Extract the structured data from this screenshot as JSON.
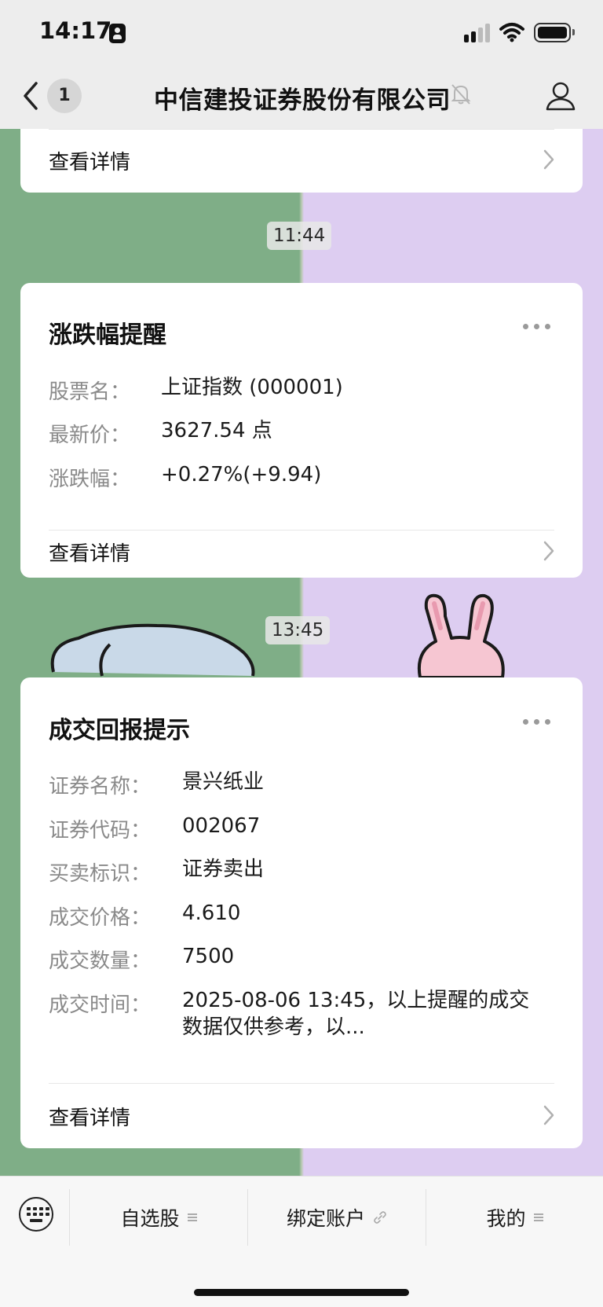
{
  "status_bar": {
    "time": "14:17",
    "icons": [
      "person-badge-icon",
      "signal-icon",
      "wifi-icon",
      "battery-icon"
    ]
  },
  "nav": {
    "back_count": "1",
    "title": "中信建投证券股份有限公司",
    "icons": [
      "back-icon",
      "bell-muted-icon",
      "profile-icon"
    ]
  },
  "cards": [
    {
      "detail_label": "查看详情"
    },
    {
      "time": "11:44",
      "title": "涨跌幅提醒",
      "rows": [
        {
          "label": "股票名：",
          "value": "上证指数 (000001)"
        },
        {
          "label": "最新价：",
          "value": "3627.54 点"
        },
        {
          "label": "涨跌幅：",
          "value": "+0.27%(+9.94)"
        }
      ],
      "detail_label": "查看详情"
    },
    {
      "time": "13:45",
      "title": "成交回报提示",
      "rows": [
        {
          "label": "证券名称：",
          "value": "景兴纸业"
        },
        {
          "label": "证券代码：",
          "value": "002067"
        },
        {
          "label": "买卖标识：",
          "value": "证券卖出"
        },
        {
          "label": "成交价格：",
          "value": "4.610"
        },
        {
          "label": "成交数量：",
          "value": "7500"
        },
        {
          "label": "成交时间：",
          "value_line1": "2025-08-06 13:45，以上提醒的成交",
          "value_line2": "数据仅供参考，以..."
        }
      ],
      "detail_label": "查看详情"
    }
  ],
  "bottom_menu": {
    "items": [
      {
        "label": "自选股",
        "icon": "menu-lines-icon"
      },
      {
        "label": "绑定账户",
        "icon": "link-icon"
      },
      {
        "label": "我的",
        "icon": "menu-lines-icon"
      }
    ]
  },
  "colors": {
    "bar_bg": "#ededed",
    "chat_bg_left": "#7fae87",
    "chat_bg_right": "#ddcdf1",
    "card_bg": "#ffffff",
    "label_gray": "#8a8a8a"
  }
}
